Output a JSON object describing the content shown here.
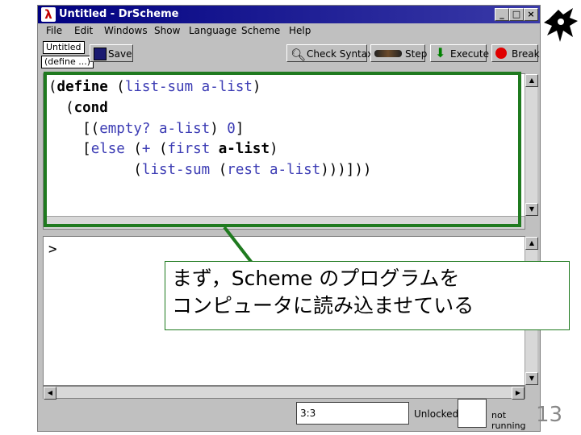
{
  "window": {
    "title": "Untitled - DrScheme",
    "app_icon": "lambda-icon",
    "controls": [
      "_",
      "□",
      "×"
    ]
  },
  "menu": [
    "File",
    "Edit",
    "Windows",
    "Show",
    "Language",
    "Scheme",
    "Help"
  ],
  "toolbar": {
    "doc_name": "Untitled",
    "define_menu": "(define ...)",
    "save": "Save",
    "check_syntax": "Check Syntax",
    "step": "Step",
    "execute": "Execute",
    "break": "Break"
  },
  "definitions": {
    "lines": [
      [
        {
          "t": "(",
          "c": "pn"
        },
        {
          "t": "define",
          "c": "kw"
        },
        {
          "t": " (",
          "c": "pn"
        },
        {
          "t": "list-sum",
          "c": "fn"
        },
        {
          "t": " a-list",
          "c": "fn"
        },
        {
          "t": ")",
          "c": "pn"
        }
      ],
      [
        {
          "t": "  (",
          "c": "pn"
        },
        {
          "t": "cond",
          "c": "kw"
        }
      ],
      [
        {
          "t": "    [(",
          "c": "pn"
        },
        {
          "t": "empty?",
          "c": "fn"
        },
        {
          "t": " a-list",
          "c": "fn"
        },
        {
          "t": ") ",
          "c": "pn"
        },
        {
          "t": "0",
          "c": "fn"
        },
        {
          "t": "]",
          "c": "pn"
        }
      ],
      [
        {
          "t": "    [",
          "c": "pn"
        },
        {
          "t": "else",
          "c": "fn"
        },
        {
          "t": " (",
          "c": "pn"
        },
        {
          "t": "+",
          "c": "fn"
        },
        {
          "t": " (",
          "c": "pn"
        },
        {
          "t": "first",
          "c": "fn"
        },
        {
          "t": " a-list",
          "c": "kw"
        },
        {
          "t": ")",
          "c": "pn"
        }
      ],
      [
        {
          "t": "          (",
          "c": "pn"
        },
        {
          "t": "list-sum",
          "c": "fn"
        },
        {
          "t": " (",
          "c": "pn"
        },
        {
          "t": "rest",
          "c": "fn"
        },
        {
          "t": " a-list",
          "c": "fn"
        },
        {
          "t": ")))]))",
          "c": "pn"
        }
      ]
    ]
  },
  "interactions": {
    "prompt": ">"
  },
  "callout": {
    "line1": "まず，Scheme のプログラムを",
    "line2": "コンピュータに読み込ませている"
  },
  "status": {
    "position": "3:3",
    "lock": "Unlocked",
    "running": "not running"
  },
  "slide_number": "13",
  "colors": {
    "highlight": "#1f7a1f",
    "keyword": "#000000",
    "identifier": "#3c3cb4",
    "titlebar": "#000080"
  }
}
